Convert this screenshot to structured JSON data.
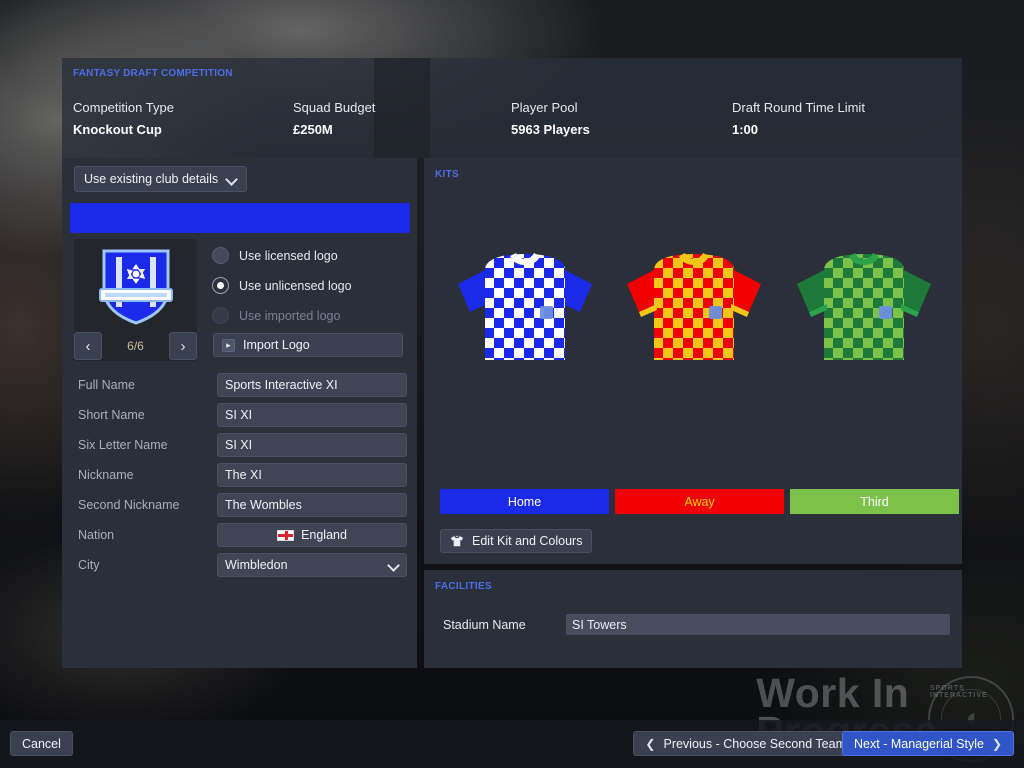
{
  "summary": {
    "header": "FANTASY DRAFT COMPETITION",
    "stats": [
      {
        "label": "Competition Type",
        "value": "Knockout Cup"
      },
      {
        "label": "Squad Budget",
        "value": "£250M"
      },
      {
        "label": "Player Pool",
        "value": "5963 Players"
      },
      {
        "label": "Draft Round Time Limit",
        "value": "1:00"
      }
    ]
  },
  "left_panel": {
    "club_details_select": "Use existing club details",
    "club_colour": "#1a2ae8",
    "badge": {
      "counter": "6/6",
      "prev_icon": "chevron-left-icon",
      "next_icon": "chevron-right-icon"
    },
    "logo_options": [
      {
        "label": "Use licensed logo",
        "selected": false,
        "disabled": false
      },
      {
        "label": "Use unlicensed logo",
        "selected": true,
        "disabled": false
      },
      {
        "label": "Use imported logo",
        "selected": false,
        "disabled": true
      }
    ],
    "import_logo_label": "Import Logo",
    "fields": [
      {
        "label": "Full Name",
        "value": "Sports Interactive XI",
        "type": "text"
      },
      {
        "label": "Short Name",
        "value": "SI XI",
        "type": "text"
      },
      {
        "label": "Six Letter Name",
        "value": "SI XI",
        "type": "text"
      },
      {
        "label": "Nickname",
        "value": "The XI",
        "type": "text"
      },
      {
        "label": "Second Nickname",
        "value": "The Wombles",
        "type": "text"
      },
      {
        "label": "Nation",
        "value": "England",
        "type": "flag"
      },
      {
        "label": "City",
        "value": "Wimbledon",
        "type": "select"
      }
    ]
  },
  "kits_panel": {
    "header": "KITS",
    "kits": [
      {
        "name": "Home",
        "primary": "#1a2ae8",
        "secondary": "#ffffff",
        "sleeve": "#1a2ae8",
        "collar": "#ffffff"
      },
      {
        "name": "Away",
        "primary": "#f00000",
        "secondary": "#f5c518",
        "sleeve": "#f00000",
        "collar": "#f5c518"
      },
      {
        "name": "Third",
        "primary": "#1d7a38",
        "secondary": "#7cc24a",
        "sleeve": "#1d7a38",
        "collar": "#2aa34a"
      }
    ],
    "tabs": [
      {
        "label": "Home",
        "bg": "#1a2ae8",
        "fg": "#ffffff"
      },
      {
        "label": "Away",
        "bg": "#f00000",
        "fg": "#ffd400"
      },
      {
        "label": "Third",
        "bg": "#7cc24a",
        "fg": "#ffffff"
      }
    ],
    "edit_button": "Edit Kit and Colours"
  },
  "facilities_panel": {
    "header": "FACILITIES",
    "stadium_label": "Stadium Name",
    "stadium_value": "SI Towers"
  },
  "watermark": {
    "text": "Work In\nProgress",
    "logo_text": "SPORTS INTERACTIVE"
  },
  "bottom_bar": {
    "cancel": "Cancel",
    "previous": "Previous - Choose Second Team",
    "next": "Next - Managerial Style"
  }
}
